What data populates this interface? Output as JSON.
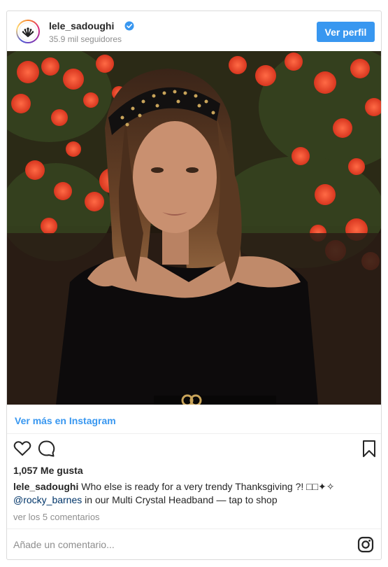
{
  "header": {
    "username": "lele_sadoughi",
    "followers": "35.9 mil seguidores",
    "view_profile_label": "Ver perfil"
  },
  "view_more_label": "Ver más en Instagram",
  "likes": "1,057 Me gusta",
  "caption": {
    "username": "lele_sadoughi",
    "text_line1": "Who else is ready for a very trendy Thanksgiving ?! □□✦✧",
    "mention": "@rocky_barnes",
    "text_line2": "in our Multi Crystal Headband — tap to shop"
  },
  "comments_link": "ver los 5 comentarios",
  "comment_placeholder": "Añade un comentario...",
  "icons": [
    "verified-icon",
    "heart-icon",
    "comment-icon",
    "bookmark-icon",
    "instagram-icon"
  ],
  "colors": {
    "accent": "#3897f0",
    "text": "#262626",
    "muted": "#8e8e8e",
    "mention": "#003569"
  }
}
